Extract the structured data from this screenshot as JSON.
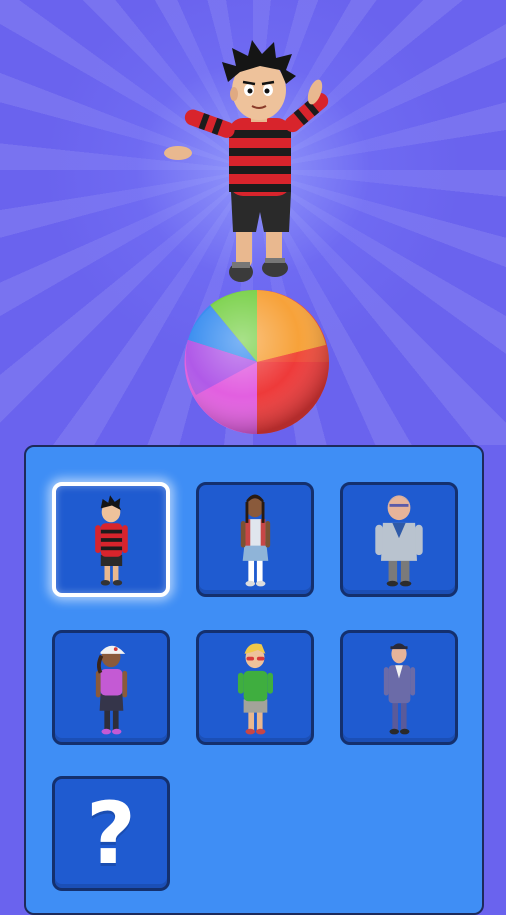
{
  "hero": {
    "character": "boy-striped-jumper",
    "ball": "rainbow-beach-ball"
  },
  "character_panel": {
    "selected_index": 0,
    "slots": [
      {
        "id": "slot-boy-striped",
        "character": "boy-striped-jumper",
        "locked": false
      },
      {
        "id": "slot-girl-braids",
        "character": "girl-braids",
        "locked": false
      },
      {
        "id": "slot-old-man",
        "character": "old-man-grey-cardigan",
        "locked": false
      },
      {
        "id": "slot-girl-cap",
        "character": "girl-white-cap",
        "locked": false
      },
      {
        "id": "slot-boy-green",
        "character": "boy-green-shirt-sunglasses",
        "locked": false
      },
      {
        "id": "slot-man-purple",
        "character": "man-purple-suit",
        "locked": false
      },
      {
        "id": "slot-mystery",
        "character": "mystery",
        "locked": true,
        "label": "?"
      }
    ]
  },
  "colors": {
    "background": "#6a63ee",
    "panel": "#3f8ef5",
    "slot": "#1f5bd0",
    "slot_border": "#14306e",
    "selected_border": "#ffffff"
  }
}
